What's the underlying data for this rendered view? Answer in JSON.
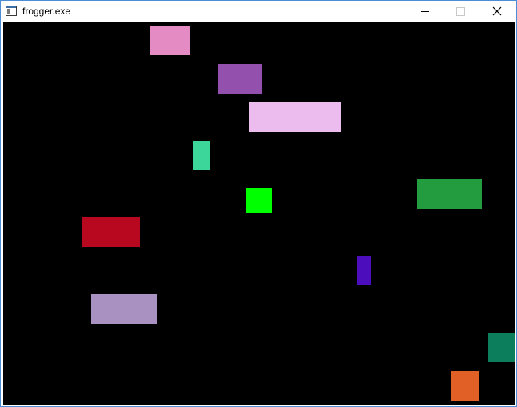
{
  "window": {
    "title": "frogger.exe",
    "icon": "app-window-icon",
    "controls": {
      "minimize_icon": "minimize-icon",
      "maximize_icon": "maximize-icon",
      "close_icon": "close-icon"
    }
  },
  "game": {
    "background_color": "#000000",
    "frog": {
      "color": "#00ff00"
    },
    "obstacles": [
      {
        "name": "obstacle-pink",
        "color": "#e38bc2"
      },
      {
        "name": "obstacle-purple",
        "color": "#9350ac"
      },
      {
        "name": "obstacle-light-pink",
        "color": "#ecbcef"
      },
      {
        "name": "obstacle-teal",
        "color": "#3cd69a"
      },
      {
        "name": "obstacle-green",
        "color": "#229c3f"
      },
      {
        "name": "obstacle-red",
        "color": "#b80820"
      },
      {
        "name": "obstacle-indigo",
        "color": "#4c0ebd"
      },
      {
        "name": "obstacle-lavender",
        "color": "#a992c1"
      },
      {
        "name": "obstacle-dark-teal",
        "color": "#0d7e5c"
      },
      {
        "name": "obstacle-orange",
        "color": "#e06026"
      }
    ]
  }
}
